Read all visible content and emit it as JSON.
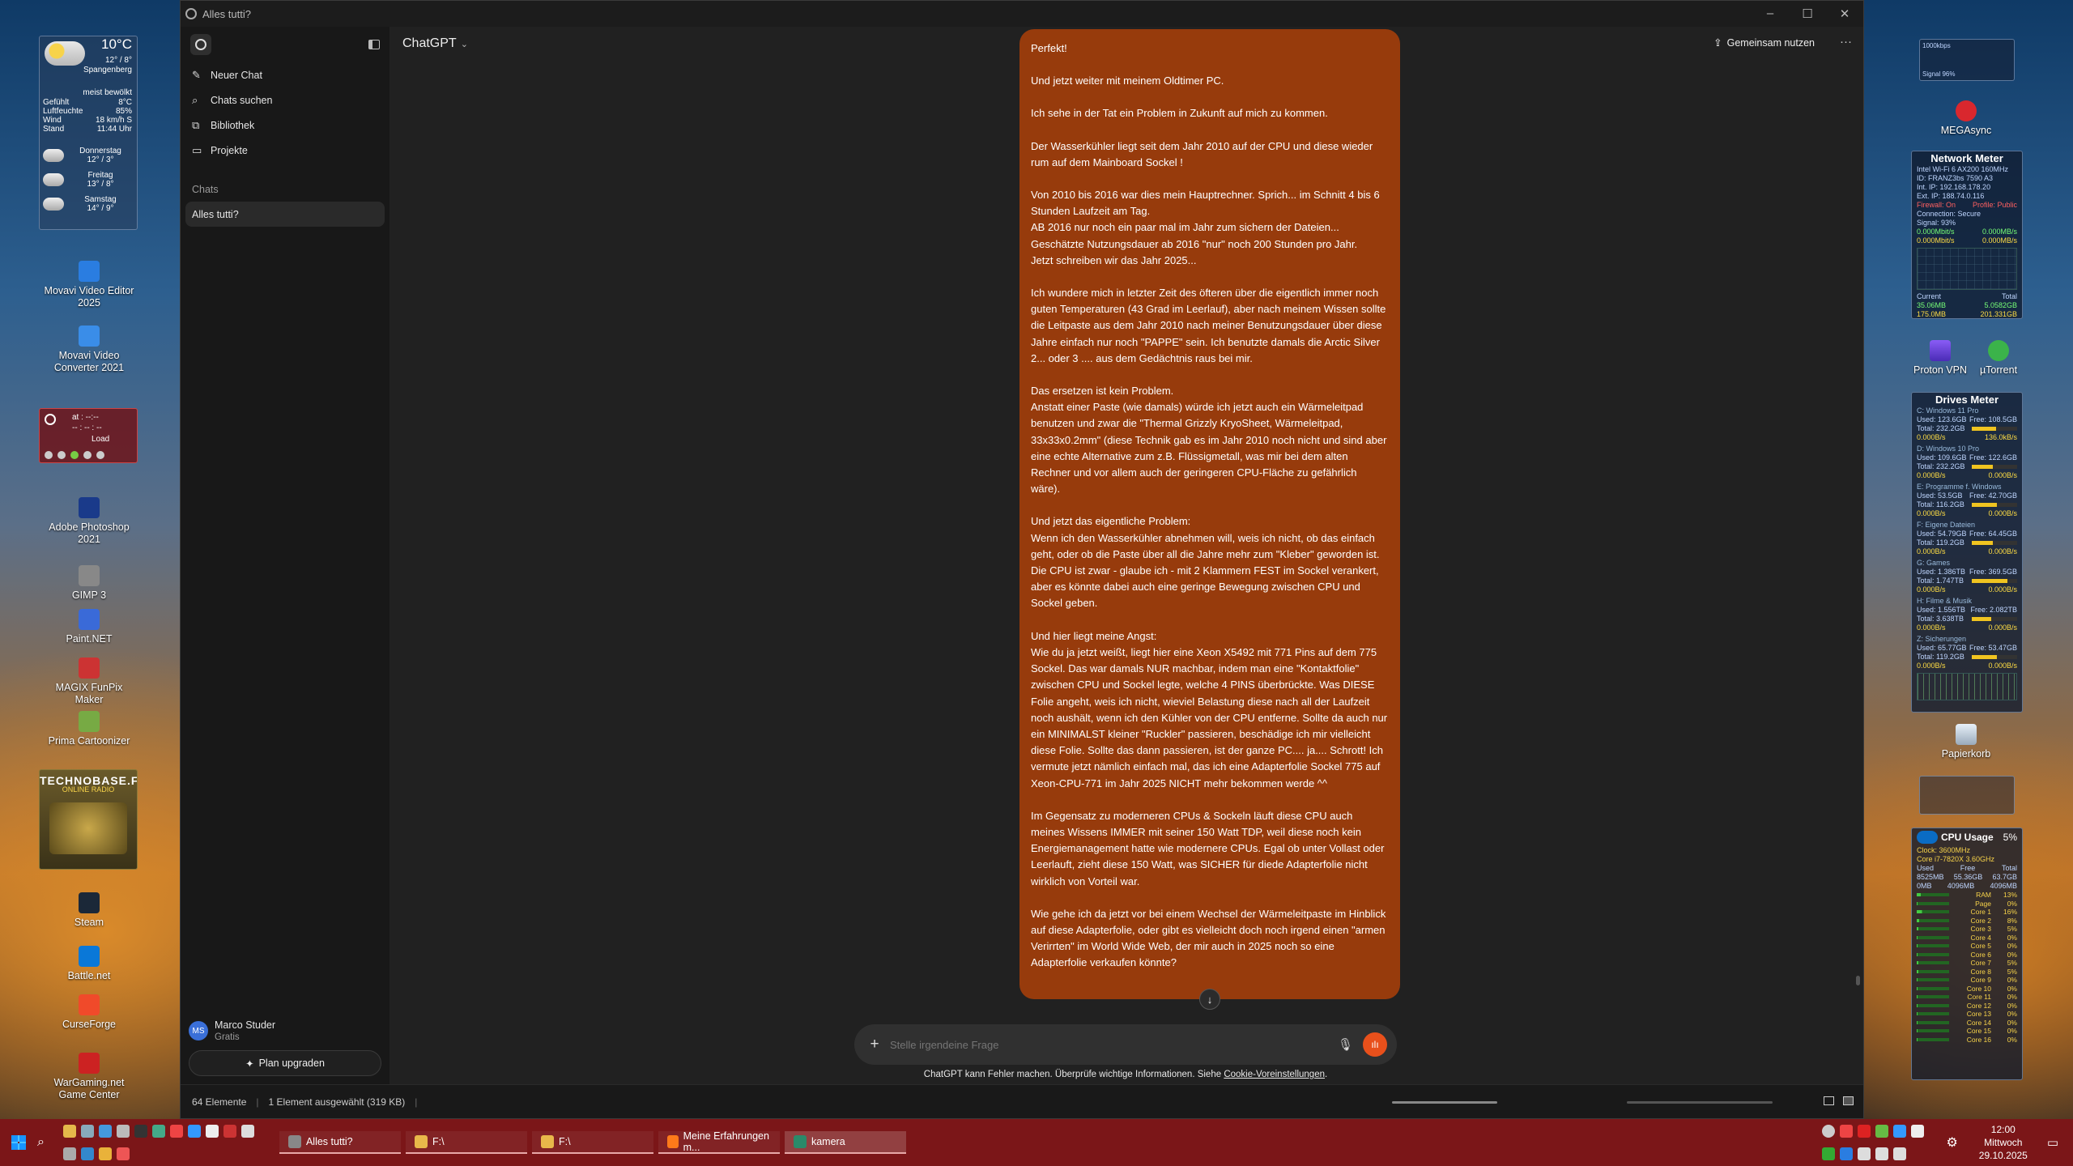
{
  "weather": {
    "temp": "10°C",
    "range": "12° / 8°",
    "city": "Spangenberg",
    "cond": "meist bewölkt",
    "rows": [
      [
        "Gefühlt",
        "8°C"
      ],
      [
        "Luftfeuchte",
        "85%"
      ],
      [
        "Wind",
        "18 km/h S"
      ],
      [
        "Stand",
        "11:44 Uhr"
      ]
    ],
    "forecast": [
      [
        "Donnerstag",
        "12° / 3°"
      ],
      [
        "Freitag",
        "13° / 8°"
      ],
      [
        "Samstag",
        "14° / 9°"
      ]
    ]
  },
  "desktop_left": [
    "Movavi Video Editor 2025",
    "Movavi Video Converter 2021",
    "Adobe Photoshop 2021",
    "GIMP 3",
    "Paint.NET",
    "MAGIX FunPix Maker",
    "Prima Cartoonizer",
    "Steam",
    "Battle.net",
    "CurseForge",
    "WarGaming.net Game Center"
  ],
  "clock_widget": {
    "top": "at : --:--",
    "mid": "-- : -- : --",
    "label": "Load"
  },
  "radio": {
    "name": "TECHNOBASE.FM",
    "sub": "ONLINE RADIO"
  },
  "desktop_right": {
    "megasync": "MEGAsync",
    "proton": "Proton VPN",
    "utorrent": "µTorrent",
    "bin": "Papierkorb"
  },
  "net_graph": {
    "top": "1000kbps",
    "bottom": "Signal 96%"
  },
  "network": {
    "title": "Network Meter",
    "lines": [
      "Intel Wi-Fi 6 AX200 160MHz",
      "ID: FRANZ3bs 7590 A3",
      "Int. IP: 192.168.178.20",
      "Ext. IP: 188.74.0.116"
    ],
    "fw": [
      "Firewall: On",
      "Profile: Public"
    ],
    "conn": "Connection: Secure",
    "signal": "Signal: 93%",
    "up": [
      "0.000Mbit/s",
      "0.000MB/s"
    ],
    "down": [
      "0.000Mbit/s",
      "0.000MB/s"
    ],
    "cur": [
      "Current",
      "Total"
    ],
    "curup": [
      "35.06MB",
      "5.0582GB"
    ],
    "curdown": [
      "175.0MB",
      "201.331GB"
    ]
  },
  "drives": {
    "title": "Drives Meter",
    "items": [
      {
        "name": "C: Windows 11 Pro",
        "used": "Used: 123.6GB",
        "free": "Free: 108.5GB",
        "total": "Total: 232.2GB",
        "r": "0.000B/s",
        "w": "136.0kB/s",
        "pct": 0.53
      },
      {
        "name": "D: Windows 10 Pro",
        "used": "Used: 109.6GB",
        "free": "Free: 122.6GB",
        "total": "Total: 232.2GB",
        "r": "0.000B/s",
        "w": "0.000B/s",
        "pct": 0.47
      },
      {
        "name": "E: Programme f. Windows",
        "used": "Used: 53.5GB",
        "free": "Free: 42.70GB",
        "total": "Total: 116.2GB",
        "r": "0.000B/s",
        "w": "0.000B/s",
        "pct": 0.55
      },
      {
        "name": "F: Eigene Dateien",
        "used": "Used: 54.79GB",
        "free": "Free: 64.45GB",
        "total": "Total: 119.2GB",
        "r": "0.000B/s",
        "w": "0.000B/s",
        "pct": 0.46
      },
      {
        "name": "G: Games",
        "used": "Used: 1.386TB",
        "free": "Free: 369.5GB",
        "total": "Total: 1.747TB",
        "r": "0.000B/s",
        "w": "0.000B/s",
        "pct": 0.79
      },
      {
        "name": "H: Filme & Musik",
        "used": "Used: 1.556TB",
        "free": "Free: 2.082TB",
        "total": "Total: 3.638TB",
        "r": "0.000B/s",
        "w": "0.000B/s",
        "pct": 0.43
      },
      {
        "name": "Z: Sicherungen",
        "used": "Used: 65.77GB",
        "free": "Free: 53.47GB",
        "total": "Total: 119.2GB",
        "r": "0.000B/s",
        "w": "0.000B/s",
        "pct": 0.55
      }
    ]
  },
  "cpu": {
    "title": "CPU Usage",
    "pct": "5%",
    "clock": "Clock: 3600MHz",
    "model": "Core i7-7820X 3.60GHz",
    "mem_head": [
      "Used",
      "Free",
      "Total"
    ],
    "mem": [
      "8525MB",
      "55.36GB",
      "63.7GB"
    ],
    "mem2": [
      "0MB",
      "4096MB",
      "4096MB"
    ],
    "cores": [
      [
        "RAM",
        "13%"
      ],
      [
        "Page",
        "0%"
      ],
      [
        "Core 1",
        "16%"
      ],
      [
        "Core 2",
        "8%"
      ],
      [
        "Core 3",
        "5%"
      ],
      [
        "Core 4",
        "0%"
      ],
      [
        "Core 5",
        "0%"
      ],
      [
        "Core 6",
        "0%"
      ],
      [
        "Core 7",
        "5%"
      ],
      [
        "Core 8",
        "5%"
      ],
      [
        "Core 9",
        "0%"
      ],
      [
        "Core 10",
        "0%"
      ],
      [
        "Core 11",
        "0%"
      ],
      [
        "Core 12",
        "0%"
      ],
      [
        "Core 13",
        "0%"
      ],
      [
        "Core 14",
        "0%"
      ],
      [
        "Core 15",
        "0%"
      ],
      [
        "Core 16",
        "0%"
      ]
    ]
  },
  "window": {
    "title": "Alles tutti?",
    "minimize": "–",
    "maximize": "☐",
    "close": "✕"
  },
  "sidebar": {
    "items": [
      "Neuer Chat",
      "Chats suchen",
      "Bibliothek",
      "Projekte"
    ],
    "section": "Chats",
    "chat": "Alles tutti?",
    "user": "Marco Studer",
    "initials": "MS",
    "plan": "Gratis",
    "upgrade": "Plan upgraden"
  },
  "header": {
    "model": "ChatGPT",
    "share": "Gemeinsam nutzen",
    "more": "···"
  },
  "message": [
    "Perfekt!",
    "Und jetzt weiter mit meinem Oldtimer PC.",
    "Ich sehe in der Tat ein Problem in Zukunft auf mich zu kommen.",
    "Der Wasserkühler liegt seit dem Jahr 2010 auf der CPU und diese wieder rum auf dem Mainboard Sockel !",
    "Von 2010 bis 2016 war dies mein Hauptrechner. Sprich... im Schnitt 4 bis 6 Stunden Laufzeit am Tag.\nAB 2016 nur noch ein paar mal im Jahr zum sichern der Dateien...\nGeschätzte Nutzungsdauer ab 2016 \"nur\" noch 200 Stunden pro Jahr.\nJetzt schreiben wir das Jahr 2025...",
    "Ich wundere mich in letzter Zeit des öfteren über die eigentlich immer noch guten Temperaturen (43 Grad im Leerlauf), aber nach meinem Wissen sollte die Leitpaste aus dem Jahr 2010 nach meiner Benutzungsdauer über diese Jahre einfach nur noch \"PAPPE\" sein. Ich benutzte damals die Arctic Silver 2... oder 3 .... aus dem Gedächtnis raus bei mir.",
    "Das ersetzen ist kein Problem.\nAnstatt einer Paste (wie damals) würde ich jetzt auch ein Wärmeleitpad benutzen und zwar die \"Thermal Grizzly KryoSheet, Wärmeleitpad, 33x33x0.2mm\" (diese Technik gab es im Jahr 2010 noch nicht und sind aber eine echte Alternative zum z.B. Flüssigmetall, was mir bei dem alten Rechner und vor allem auch der geringeren CPU-Fläche zu gefährlich wäre).",
    "Und jetzt das eigentliche Problem:\nWenn ich den Wasserkühler abnehmen will, weis ich nicht, ob das einfach geht, oder ob die Paste über all die Jahre mehr zum \"Kleber\" geworden ist. Die CPU ist zwar - glaube ich - mit 2 Klammern FEST im Sockel verankert, aber es könnte dabei auch eine geringe Bewegung zwischen CPU und Sockel geben.",
    "Und hier liegt meine Angst:\nWie du ja jetzt weißt, liegt hier eine Xeon X5492 mit 771 Pins auf dem 775 Sockel. Das war damals NUR machbar, indem man eine \"Kontaktfolie\" zwischen CPU und Sockel legte, welche 4 PINS überbrückte. Was DIESE Folie angeht, weis ich nicht, wieviel Belastung diese nach all der Laufzeit noch aushält, wenn ich den Kühler von der CPU entferne. Sollte da auch nur ein MINIMALST kleiner \"Ruckler\" passieren, beschädige ich mir vielleicht diese Folie. Sollte das dann passieren, ist der ganze PC.... ja.... Schrott! Ich vermute jetzt nämlich einfach mal, das ich eine Adapterfolie Sockel 775 auf Xeon-CPU-771 im Jahr 2025 NICHT mehr bekommen werde ^^",
    "Im Gegensatz zu moderneren CPUs & Sockeln läuft diese CPU auch meines Wissens IMMER mit seiner 150 Watt TDP, weil diese noch kein Energiemanagement hatte wie modernere CPUs. Egal ob unter Vollast oder Leerlauft, zieht diese 150 Watt, was SICHER für diede Adapterfolie nicht wirklich von Vorteil war.",
    "Wie gehe ich da jetzt vor bei einem Wechsel der Wärmeleitpaste im Hinblick auf diese Adapterfolie, oder gibt es vielleicht doch noch irgend einen \"armen Verirrten\" im World Wide Web, der mir auch in 2025 noch so eine Adapterfolie verkaufen könnte?"
  ],
  "composer": {
    "placeholder": "Stelle irgendeine Frage",
    "disclaimer": "ChatGPT kann Fehler machen. Überprüfe wichtige Informationen. Siehe",
    "link": "Cookie-Voreinstellungen",
    "end": "."
  },
  "statusbar": {
    "count": "64 Elemente",
    "sel": "1 Element ausgewählt (319 KB)",
    "sep": "|"
  },
  "taskbar": {
    "tasks": [
      "Alles tutti?",
      "F:\\",
      "F:\\",
      "Meine Erfahrungen m...",
      "kamera"
    ],
    "time": "12:00",
    "day": "Mittwoch",
    "date": "29.10.2025"
  },
  "colors": {
    "bubble": "#973b0c",
    "taskbar": "#7b1618",
    "voice": "#e8501b"
  }
}
